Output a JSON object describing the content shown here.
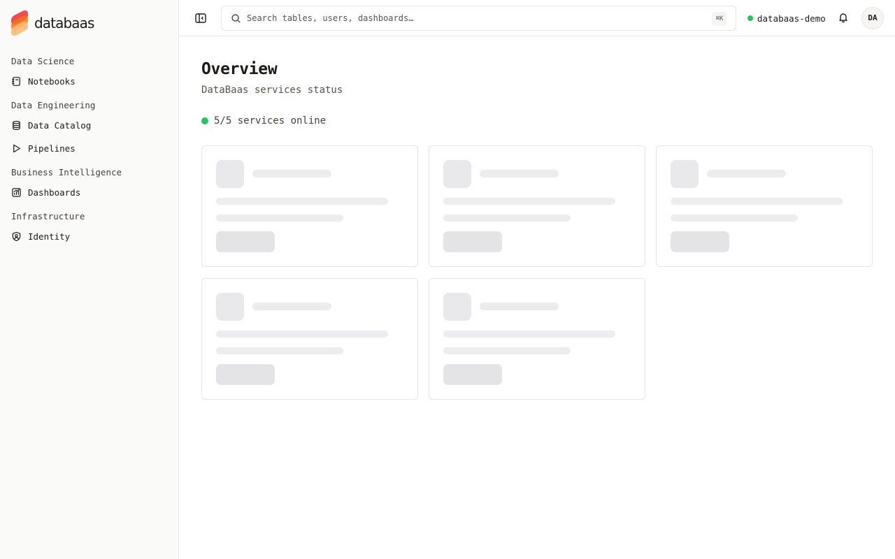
{
  "app": {
    "brand": "databaas",
    "brand_colors": [
      "#ef4444",
      "#f97316",
      "#fdba74"
    ]
  },
  "sidebar": {
    "sections": [
      {
        "title": "Data Science",
        "items": [
          {
            "label": "Notebooks",
            "icon": "notebook-icon"
          }
        ]
      },
      {
        "title": "Data Engineering",
        "items": [
          {
            "label": "Data Catalog",
            "icon": "database-icon"
          },
          {
            "label": "Pipelines",
            "icon": "play-icon"
          }
        ]
      },
      {
        "title": "Business Intelligence",
        "items": [
          {
            "label": "Dashboards",
            "icon": "chart-icon"
          }
        ]
      },
      {
        "title": "Infrastructure",
        "items": [
          {
            "label": "Identity",
            "icon": "shield-user-icon"
          }
        ]
      }
    ]
  },
  "header": {
    "search_placeholder": "Search tables, users, dashboards…",
    "shortcut": "⌘K",
    "environment": "databaas-demo",
    "environment_status_color": "#22c55e",
    "avatar_initials": "DA"
  },
  "main": {
    "title": "Overview",
    "subtitle": "DataBaas services status",
    "status_text": "5/5 services online",
    "status_color": "#22c55e",
    "loading_cards": 5
  }
}
